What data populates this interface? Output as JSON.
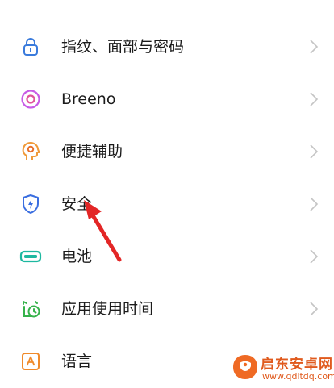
{
  "settings_list": {
    "items": [
      {
        "label": "指纹、面部与密码",
        "icon": "lock-icon",
        "color": "#3a7bdc"
      },
      {
        "label": "Breeno",
        "icon": "breeno-icon",
        "color": "#c85be6"
      },
      {
        "label": "便捷辅助",
        "icon": "head-gear-icon",
        "color": "#f09a3a"
      },
      {
        "label": "安全",
        "icon": "shield-bolt-icon",
        "color": "#3a6ee0"
      },
      {
        "label": "电池",
        "icon": "battery-icon",
        "color": "#1db8a0"
      },
      {
        "label": "应用使用时间",
        "icon": "alarm-clock-icon",
        "color": "#35b24a"
      },
      {
        "label": "语言",
        "icon": "language-icon",
        "color": "#f08a2a"
      }
    ]
  },
  "annotation": {
    "arrow_color": "#e32626"
  },
  "watermark": {
    "title": "启东安卓网",
    "url": "www.qdltdq.com"
  }
}
